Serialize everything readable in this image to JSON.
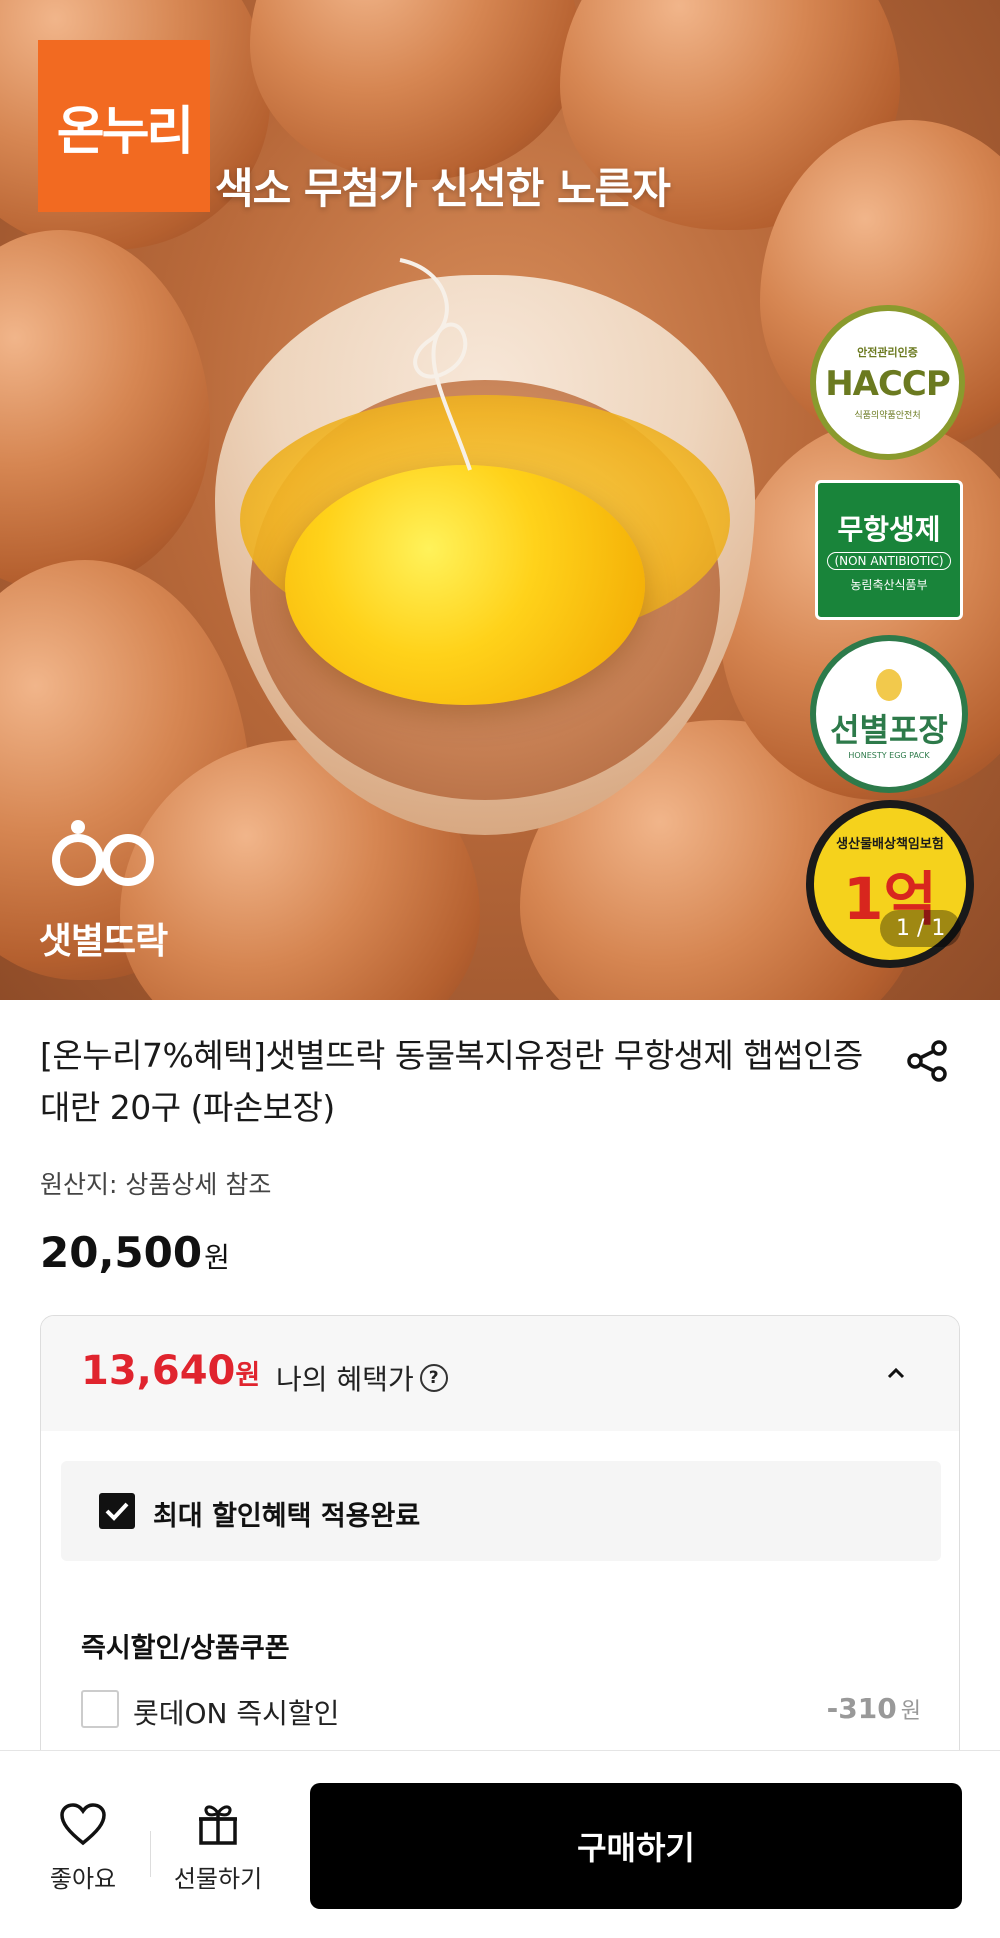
{
  "hero": {
    "brand_logo": "온누리",
    "tagline": "색소 무첨가 신선한 노른자",
    "cert_haccp_top": "안전관리인증",
    "cert_haccp_main": "HACCP",
    "cert_haccp_bottom": "식품의약품안전처",
    "cert_antibiotic_main": "무항생제",
    "cert_antibiotic_sub": "(NON ANTIBIOTIC)",
    "cert_antibiotic_bottom": "농림축산식품부",
    "cert_pack_main": "선별포장",
    "cert_pack_sub": "HONESTY EGG PACK",
    "cert_liability_main": "1억",
    "cert_liability_ring": "생산물배상책임보험",
    "brand_mark_name": "샛별뜨락",
    "image_counter": "1 / 1"
  },
  "product": {
    "title": "[온누리7%혜택]샛별뜨락 동물복지유정란 무항생제 햅썹인증 대란 20구 (파손보장)",
    "origin": "원산지: 상품상세 참조",
    "price": "20,500",
    "price_unit": "원"
  },
  "benefit": {
    "price": "13,640",
    "price_unit": "원",
    "label": "나의 혜택가",
    "max_applied": "최대 할인혜택 적용완료",
    "section_title": "즉시할인/상품쿠폰",
    "discount_label": "롯데ON 즉시할인",
    "discount_amount": "-310",
    "discount_unit": "원"
  },
  "bottom_bar": {
    "like_label": "좋아요",
    "gift_label": "선물하기",
    "buy_label": "구매하기"
  },
  "colors": {
    "accent_red": "#e0242e",
    "logo_orange": "#f26a21",
    "buy_button": "#000000"
  }
}
